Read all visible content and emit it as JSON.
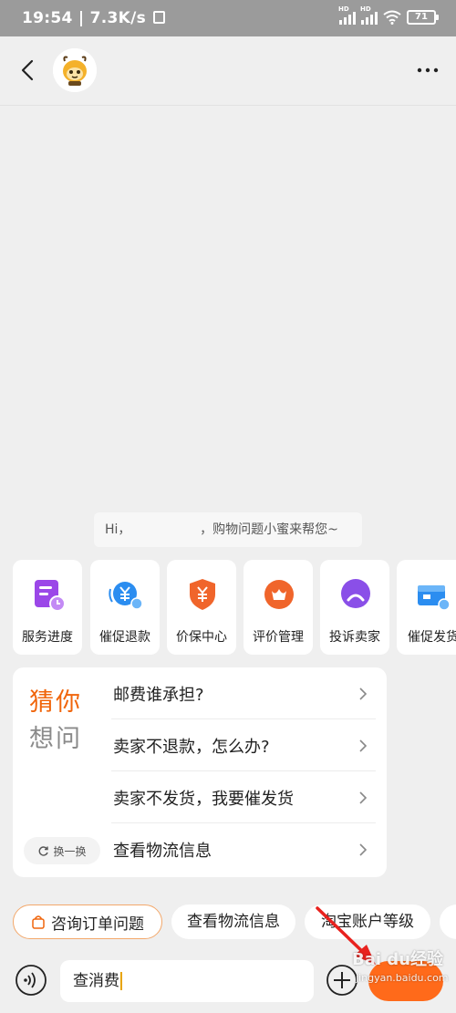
{
  "status_bar": {
    "time": "19:54",
    "net_speed": "7.3K/s",
    "battery": "71"
  },
  "greeting": {
    "text": "Hi，                 ，购物问题小蜜来帮您~"
  },
  "quick_actions": [
    {
      "label": "服务进度",
      "icon": "service-progress-icon",
      "color": "#9b47e8"
    },
    {
      "label": "催促退款",
      "icon": "refund-urge-icon",
      "color": "#2b8df0"
    },
    {
      "label": "价保中心",
      "icon": "price-protection-icon",
      "color": "#f0652b"
    },
    {
      "label": "评价管理",
      "icon": "review-icon",
      "color": "#f0652b"
    },
    {
      "label": "投诉卖家",
      "icon": "complaint-icon",
      "color": "#8a4fe8"
    },
    {
      "label": "催促发货",
      "icon": "shipping-urge-icon",
      "color": "#2b8df0"
    }
  ],
  "guess": {
    "title_line1": "猜你",
    "title_line2": "想问",
    "refresh_label": "换一换",
    "questions": [
      "邮费谁承担?",
      "卖家不退款，怎么办?",
      "卖家不发货，我要催发货",
      "查看物流信息"
    ]
  },
  "chips": [
    "咨询订单问题",
    "查看物流信息",
    "淘宝账户等级"
  ],
  "input": {
    "value": "查消费"
  },
  "watermark": {
    "line1": "Bai du经验",
    "line2": "jingyan.baidu.com"
  },
  "colors": {
    "accent": "#ff6a1a",
    "status_bar": "#9b9b9b",
    "background": "#efefef"
  }
}
